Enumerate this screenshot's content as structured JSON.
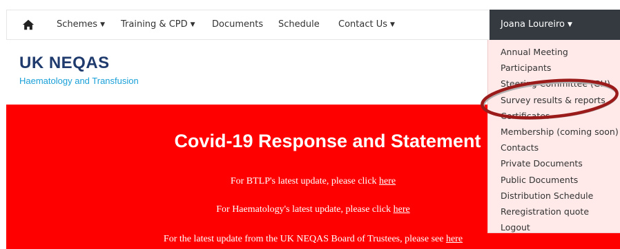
{
  "nav": {
    "home_icon": "home-icon",
    "items": [
      {
        "label": "Schemes",
        "has_caret": true
      },
      {
        "label": "Training & CPD",
        "has_caret": true
      },
      {
        "label": "Documents",
        "has_caret": false
      },
      {
        "label": "Schedule",
        "has_caret": false
      },
      {
        "label": "Contact Us",
        "has_caret": true
      }
    ],
    "user": {
      "name": "Joana Loureiro"
    }
  },
  "brand": {
    "title": "UK NEQAS",
    "subtitle": "Haematology and Transfusion"
  },
  "banner": {
    "heading": "Covid-19 Response and Statement",
    "lines": [
      {
        "text": "For BTLP's latest update, please click ",
        "link": "here"
      },
      {
        "text": "For Haematology's latest update, please click ",
        "link": "here"
      },
      {
        "text": "For the latest update from the UK NEQAS Board of Trustees, please see ",
        "link": "here"
      }
    ]
  },
  "dropdown": {
    "items": [
      "Annual Meeting",
      "Participants",
      "Steering Committee (GH)",
      "Survey results & reports",
      "Certificates",
      "Membership (coming soon)",
      "Contacts",
      "Private Documents",
      "Public Documents",
      "Distribution Schedule",
      "Reregistration quote",
      "Logout"
    ],
    "highlighted_item": "Survey results & reports"
  },
  "colors": {
    "banner_bg": "#ff0000",
    "brand_navy": "#1f3a6d",
    "brand_blue": "#1aa0d8",
    "user_menu_bg": "#343a40",
    "dropdown_bg": "#ffe9e9",
    "highlight_ring": "#9b1b1b"
  }
}
